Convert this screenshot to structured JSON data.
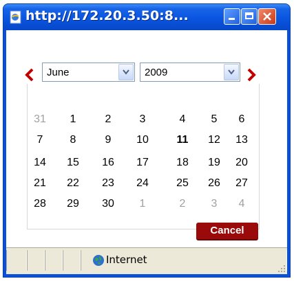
{
  "window": {
    "title": "http://172.20.3.50:8..."
  },
  "picker": {
    "month_selected": "June",
    "year_selected": "2009",
    "weeks": [
      [
        {
          "d": "31",
          "other": true
        },
        {
          "d": "1"
        },
        {
          "d": "2"
        },
        {
          "d": "3"
        },
        {
          "d": "4"
        },
        {
          "d": "5"
        },
        {
          "d": "6"
        }
      ],
      [
        {
          "d": "7"
        },
        {
          "d": "8"
        },
        {
          "d": "9"
        },
        {
          "d": "10"
        },
        {
          "d": "11",
          "today": true
        },
        {
          "d": "12"
        },
        {
          "d": "13"
        }
      ],
      [
        {
          "d": "14"
        },
        {
          "d": "15"
        },
        {
          "d": "16"
        },
        {
          "d": "17"
        },
        {
          "d": "18"
        },
        {
          "d": "19"
        },
        {
          "d": "20"
        }
      ],
      [
        {
          "d": "21"
        },
        {
          "d": "22"
        },
        {
          "d": "23"
        },
        {
          "d": "24"
        },
        {
          "d": "25"
        },
        {
          "d": "26"
        },
        {
          "d": "27"
        }
      ],
      [
        {
          "d": "28"
        },
        {
          "d": "29"
        },
        {
          "d": "30"
        },
        {
          "d": "1",
          "other": true
        },
        {
          "d": "2",
          "other": true
        },
        {
          "d": "3",
          "other": true
        },
        {
          "d": "4",
          "other": true
        }
      ]
    ],
    "cancel_label": "Cancel"
  },
  "statusbar": {
    "zone_label": "Internet"
  },
  "colors": {
    "accent": "#9a0a0a",
    "titlebar": "#0a55e0"
  }
}
